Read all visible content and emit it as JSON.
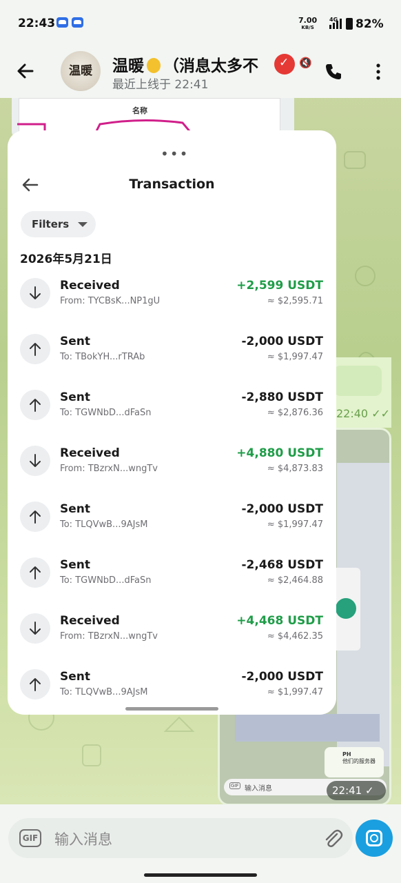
{
  "status_bar": {
    "time": "22:43",
    "net_speed": "7.00",
    "net_speed_unit": "KB/S",
    "network": "4G",
    "battery": "82%"
  },
  "chat": {
    "title_part1": "温暖",
    "title_part2": "（消息太多不",
    "last_seen": "最近上线于 22:41",
    "avatar_text": "温暖"
  },
  "background": {
    "table_header": "名称",
    "bubble_time": "22:40",
    "screenshot_card_title": "PH",
    "screenshot_card_sub": "他们的服务器",
    "screenshot_input": "输入消息",
    "screenshot_time": "22:41"
  },
  "sheet": {
    "title": "Transaction",
    "filters_label": "Filters",
    "date": "2026年5月21日",
    "transactions": [
      {
        "type": "Received",
        "address": "From: TYCBsK...NP1gU",
        "amount": "+2,599 USDT",
        "usd": "≈ $2,595.71",
        "direction": "in"
      },
      {
        "type": "Sent",
        "address": "To: TBokYH...rTRAb",
        "amount": "-2,000 USDT",
        "usd": "≈ $1,997.47",
        "direction": "out"
      },
      {
        "type": "Sent",
        "address": "To: TGWNbD...dFaSn",
        "amount": "-2,880 USDT",
        "usd": "≈ $2,876.36",
        "direction": "out"
      },
      {
        "type": "Received",
        "address": "From: TBzrxN...wngTv",
        "amount": "+4,880 USDT",
        "usd": "≈ $4,873.83",
        "direction": "in"
      },
      {
        "type": "Sent",
        "address": "To: TLQVwB...9AJsM",
        "amount": "-2,000 USDT",
        "usd": "≈ $1,997.47",
        "direction": "out"
      },
      {
        "type": "Sent",
        "address": "To: TGWNbD...dFaSn",
        "amount": "-2,468 USDT",
        "usd": "≈ $2,464.88",
        "direction": "out"
      },
      {
        "type": "Received",
        "address": "From: TBzrxN...wngTv",
        "amount": "+4,468 USDT",
        "usd": "≈ $4,462.35",
        "direction": "in"
      },
      {
        "type": "Sent",
        "address": "To: TLQVwB...9AJsM",
        "amount": "-2,000 USDT",
        "usd": "≈ $1,997.47",
        "direction": "out"
      }
    ]
  },
  "composer": {
    "gif_label": "GIF",
    "placeholder": "输入消息"
  },
  "colors": {
    "received_green": "#1f9d48",
    "send_button_blue": "#1a9fe0",
    "verified_red": "#e53935"
  }
}
